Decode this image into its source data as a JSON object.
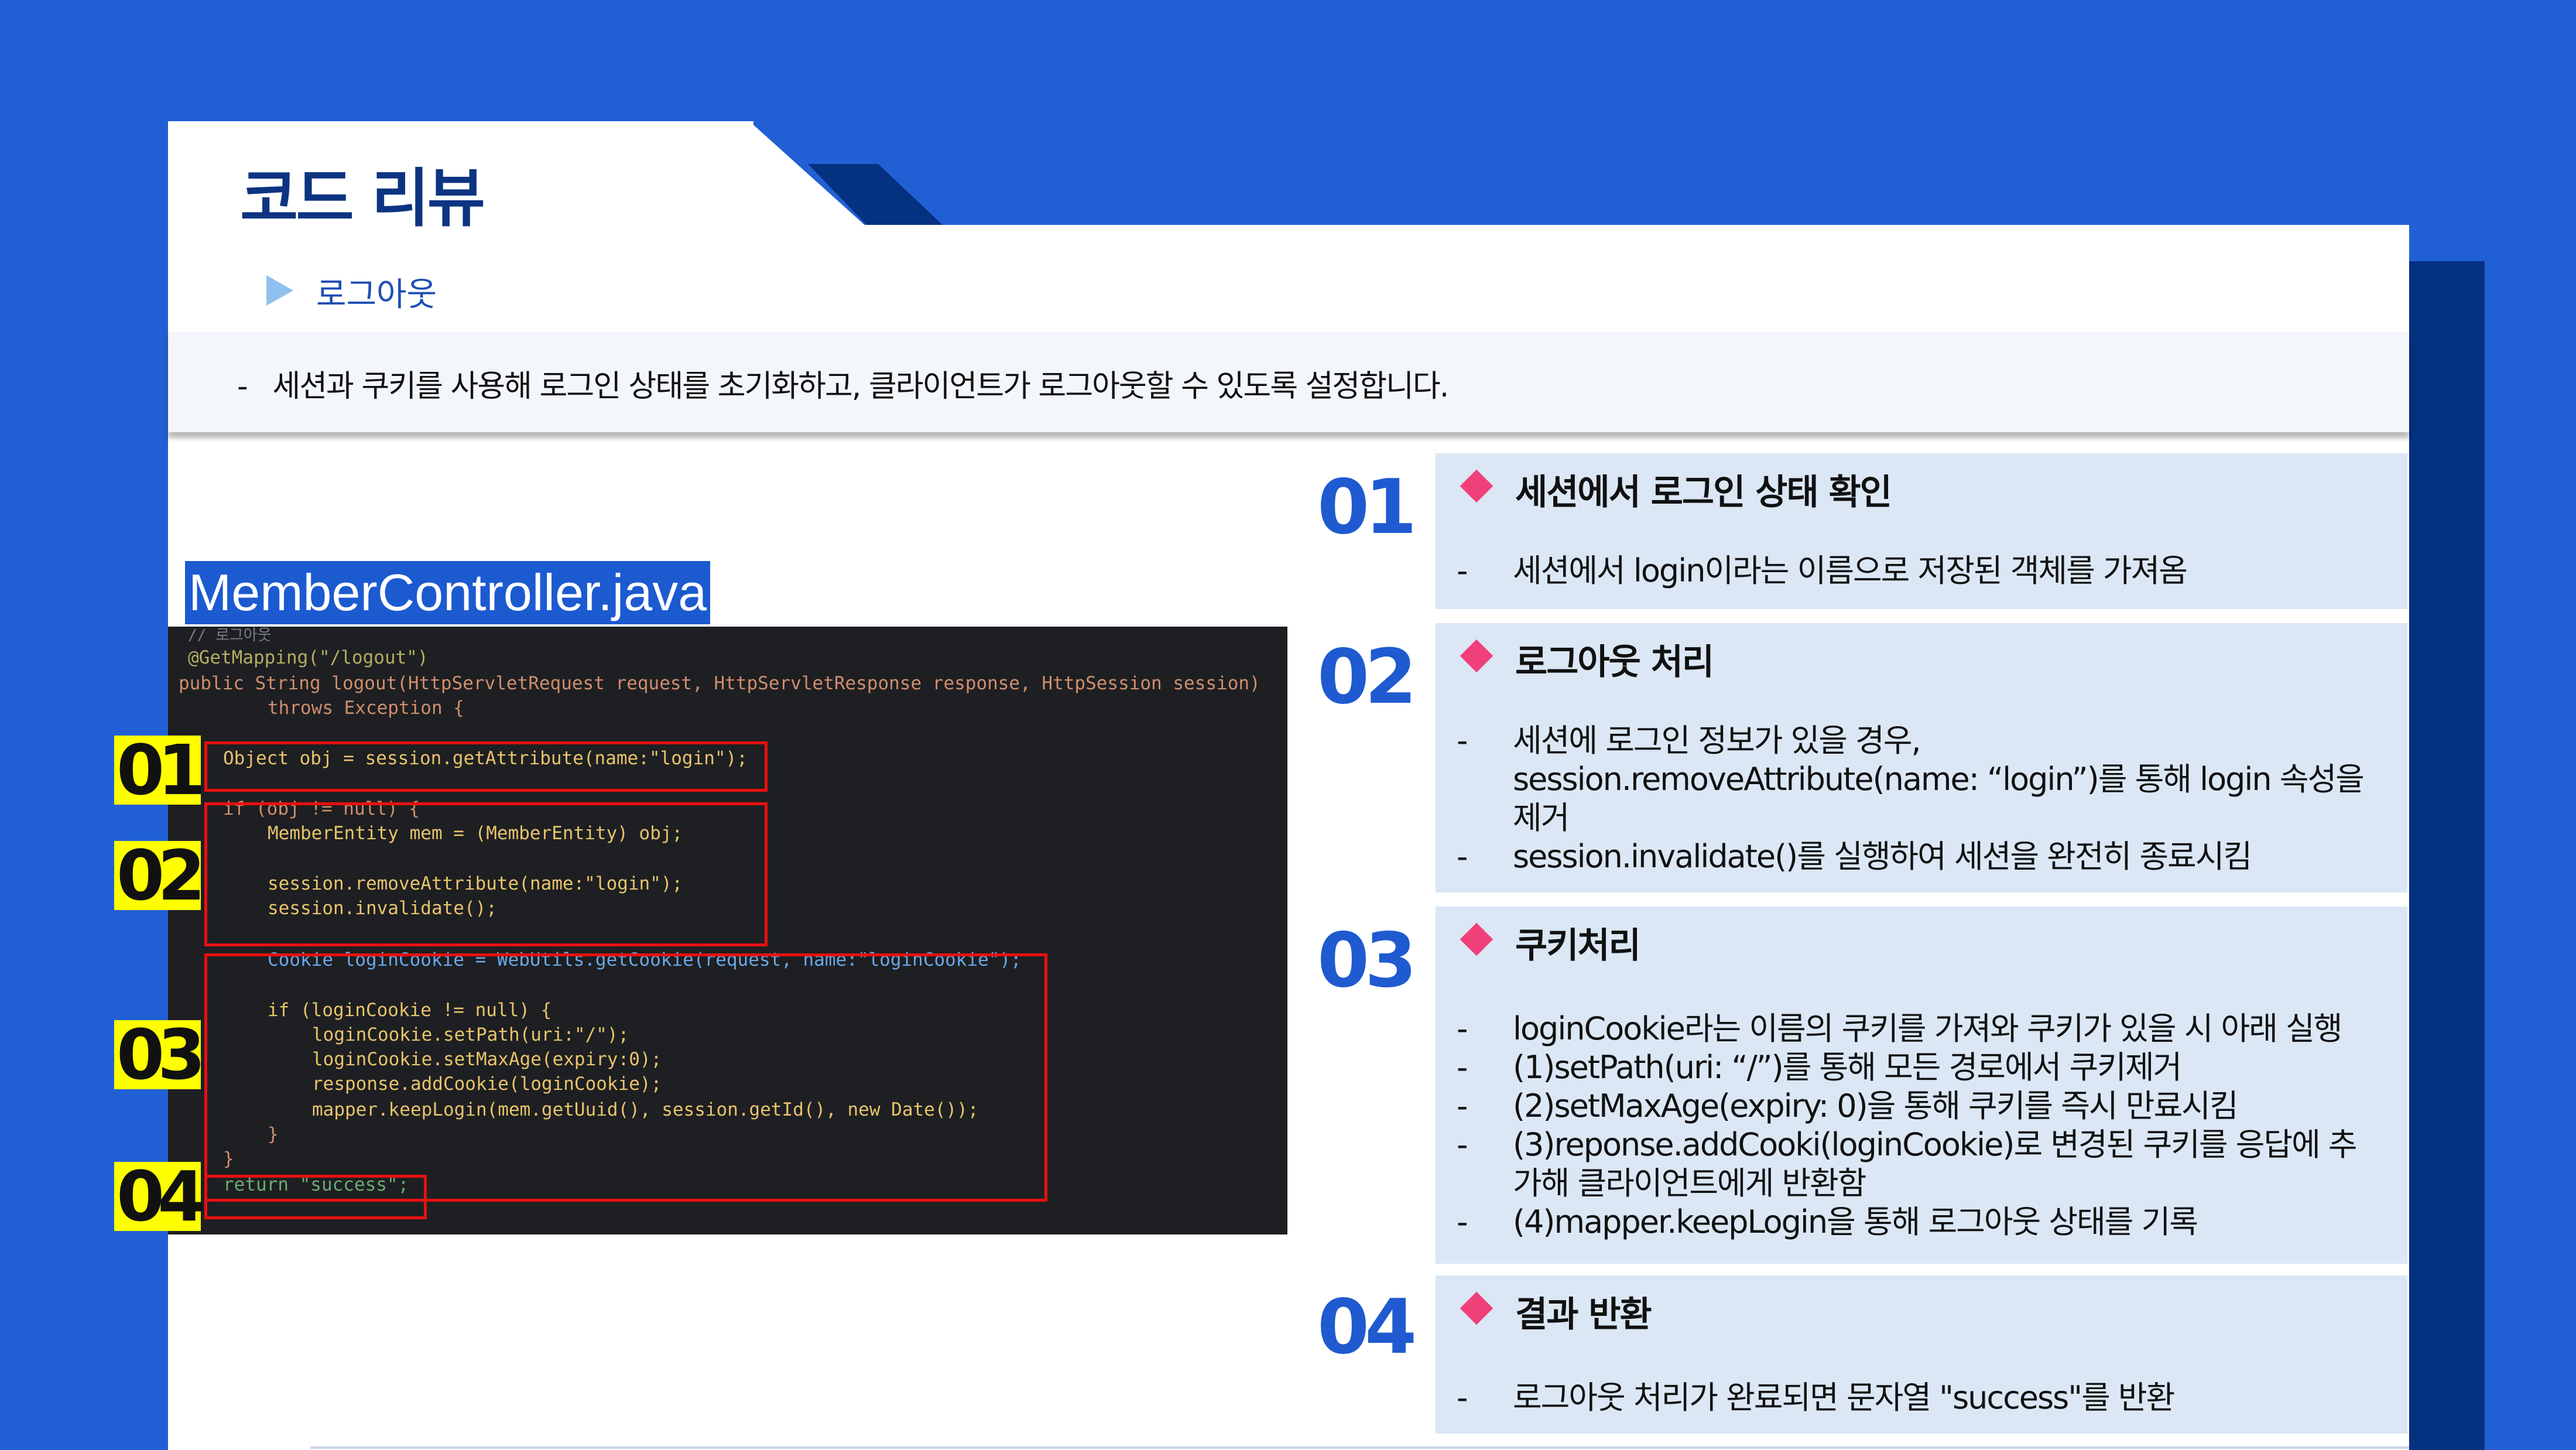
{
  "header": {
    "title": "코드 리뷰",
    "subtitle": "로그아웃",
    "description": "세션과 쿠키를 사용해 로그인 상태를 초기화하고, 클라이언트가 로그아웃할 수 있도록 설정합니다."
  },
  "code_panel": {
    "file_name": "MemberController.java",
    "badges": [
      "01",
      "02",
      "03",
      "04"
    ],
    "lines": [
      "// 로그아웃",
      "@GetMapping(\"/logout\")",
      "public String logout(HttpServletRequest request, HttpServletResponse response, HttpSession session)",
      "throws Exception {",
      "Object obj = session.getAttribute(name:\"login\");",
      "if (obj != null) {",
      "MemberEntity mem = (MemberEntity) obj;",
      "session.removeAttribute(name:\"login\");",
      "session.invalidate();",
      "Cookie loginCookie = WebUtils.getCookie(request, name:\"loginCookie\");",
      "if (loginCookie != null) {",
      "loginCookie.setPath(uri:\"/\");",
      "loginCookie.setMaxAge(expiry:0);",
      "response.addCookie(loginCookie);",
      "mapper.keepLogin(mem.getUuid(), session.getId(), new Date());",
      "}",
      "}",
      "return \"success\";"
    ]
  },
  "steps": [
    {
      "number": "01",
      "title": "세션에서 로그인 상태 확인",
      "bullets": [
        "세션에서 login이라는 이름으로 저장된 객체를 가져옴"
      ]
    },
    {
      "number": "02",
      "title": "로그아웃 처리",
      "bullets": [
        "세션에 로그인 정보가 있을 경우, session.removeAttribute(name: “login”)를 통해 login 속성을 제거",
        "session.invalidate()를 실행하여 세션을 완전히 종료시킴"
      ]
    },
    {
      "number": "03",
      "title": "쿠키처리",
      "bullets": [
        "loginCookie라는 이름의 쿠키를 가져와 쿠키가 있을 시 아래 실행",
        "(1)setPath(uri: “/”)를 통해 모든 경로에서 쿠키제거",
        "(2)setMaxAge(expiry: 0)을 통해 쿠키를 즉시 만료시킴",
        "(3)reponse.addCooki(loginCookie)로 변경된 쿠키를 응답에 추가해 클라이언트에게 반환함",
        "(4)mapper.keepLogin을 통해 로그아웃 상태를 기록"
      ]
    },
    {
      "number": "04",
      "title": "결과 반환",
      "bullets": [
        "로그아웃 처리가 완료되면 문자열 \"success\"를 반환"
      ]
    }
  ],
  "colors": {
    "background": "#2160d4",
    "title": "#0c3481",
    "accent_diamond": "#f0407a",
    "card": "#dbe7f5",
    "highlight_badge": "#ffff00",
    "code_box_border": "#e81010"
  }
}
